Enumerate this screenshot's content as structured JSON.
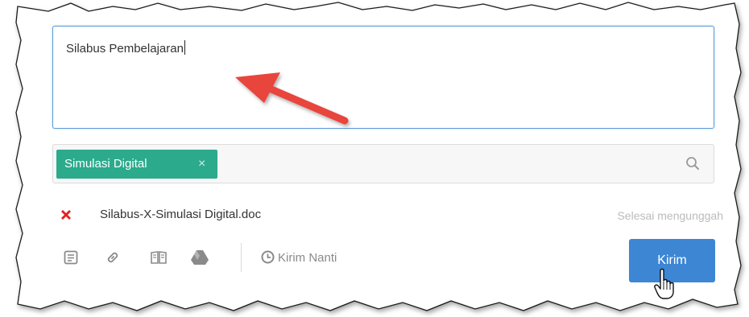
{
  "composer": {
    "text": "Silabus Pembelajaran"
  },
  "recipients": {
    "chips": [
      {
        "label": "Simulasi Digital",
        "remove": "×"
      }
    ]
  },
  "attachment": {
    "file_name": "Silabus-X-Simulasi Digital.doc",
    "status": "Selesai mengunggah"
  },
  "toolbar": {
    "icons": [
      "document-icon",
      "link-icon",
      "book-icon",
      "drive-icon"
    ],
    "schedule_label": "Kirim Nanti"
  },
  "send_button": {
    "label": "Kirim"
  },
  "colors": {
    "accent": "#3d86d4",
    "chip": "#2baa8c",
    "remove": "#e02020",
    "annotation_arrow": "#e8453c"
  }
}
